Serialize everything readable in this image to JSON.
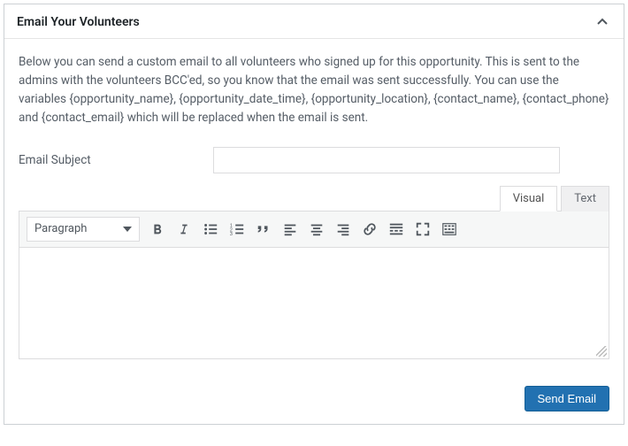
{
  "header": {
    "title": "Email Your Volunteers"
  },
  "intro": "Below you can send a custom email to all volunteers who signed up for this opportunity. This is sent to the admins with the volunteers BCC'ed, so you know that the email was sent successfully. You can use the variables {opportunity_name}, {opportunity_date_time}, {opportunity_location}, {contact_name}, {contact_phone} and {contact_email} which will be replaced when the email is sent.",
  "fields": {
    "subject_label": "Email Subject",
    "subject_value": ""
  },
  "editor": {
    "tabs": {
      "visual": "Visual",
      "text": "Text"
    },
    "format_selected": "Paragraph"
  },
  "buttons": {
    "send": "Send Email"
  }
}
